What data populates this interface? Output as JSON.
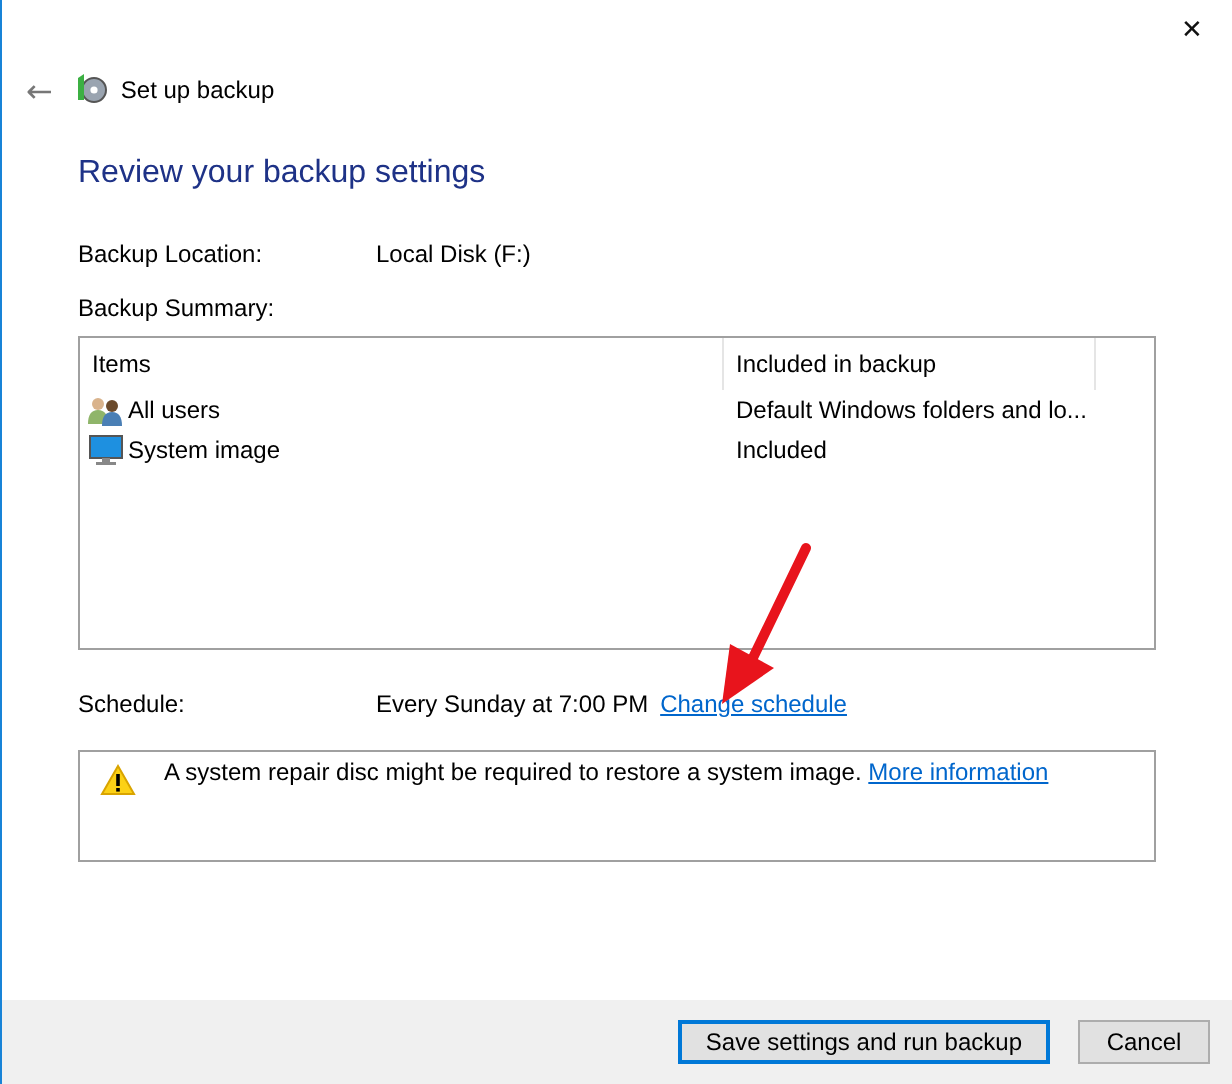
{
  "window": {
    "close": "✕"
  },
  "header": {
    "back": "←",
    "title": "Set up backup"
  },
  "heading": "Review your backup settings",
  "fields": [
    {
      "label": "Backup Location:",
      "value": "Local Disk (F:)"
    }
  ],
  "summary": {
    "label": "Backup Summary:",
    "columns": [
      "Items",
      "Included in backup"
    ],
    "rows": [
      {
        "kind": "users",
        "item": "All users",
        "included": "Default Windows folders and lo..."
      },
      {
        "kind": "monitor",
        "item": "System image",
        "included": "Included"
      }
    ]
  },
  "schedule": {
    "label": "Schedule:",
    "value": "Every Sunday at 7:00 PM",
    "link": "Change schedule"
  },
  "warning": {
    "text": "A system repair disc might be required to restore a system image.",
    "link": "More information"
  },
  "annotation": {
    "kind": "arrow"
  },
  "buttons": [
    {
      "label": "Save settings and run backup",
      "default": true
    },
    {
      "label": "Cancel",
      "default": false
    }
  ]
}
